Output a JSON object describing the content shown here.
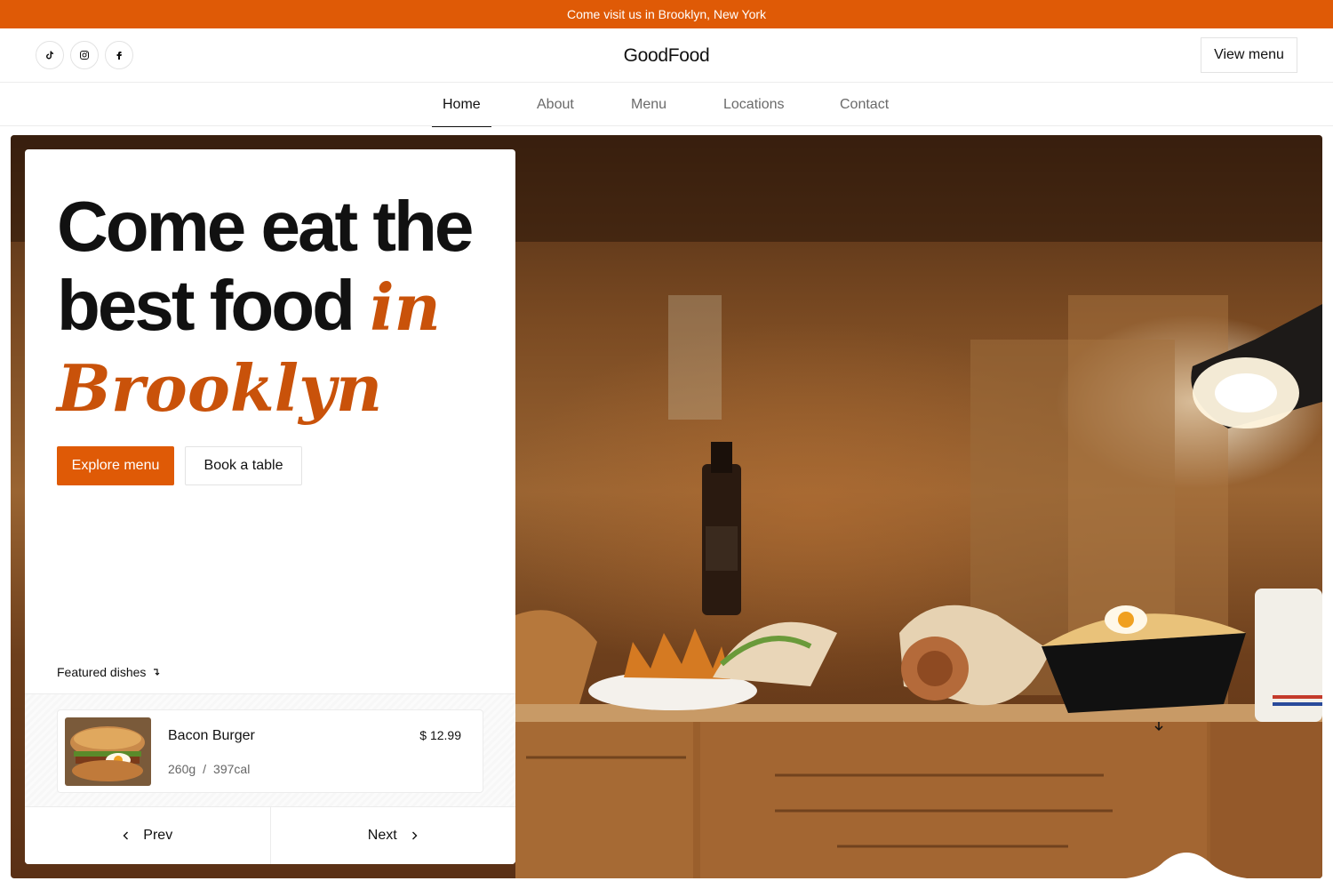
{
  "announcement": "Come visit us in Brooklyn, New York",
  "header": {
    "brand": "GoodFood",
    "view_menu_label": "View menu",
    "socials": [
      "tiktok-icon",
      "instagram-icon",
      "facebook-icon"
    ]
  },
  "nav": {
    "items": [
      {
        "label": "Home",
        "active": true
      },
      {
        "label": "About",
        "active": false
      },
      {
        "label": "Menu",
        "active": false
      },
      {
        "label": "Locations",
        "active": false
      },
      {
        "label": "Contact",
        "active": false
      }
    ]
  },
  "hero": {
    "headline_line1": "Come eat the",
    "headline_line2": "best food",
    "headline_accent_in": "in",
    "headline_accent_city": "Brooklyn",
    "primary_cta": "Explore menu",
    "secondary_cta": "Book a table",
    "featured_label": "Featured dishes",
    "featured_dish": {
      "name": "Bacon Burger",
      "price": "$ 12.99",
      "weight": "260g",
      "separator": "/",
      "calories": "397cal"
    },
    "prev_label": "Prev",
    "next_label": "Next"
  },
  "colors": {
    "accent": "#df5a06",
    "accent_text": "#c9520a",
    "border": "#ececec"
  }
}
